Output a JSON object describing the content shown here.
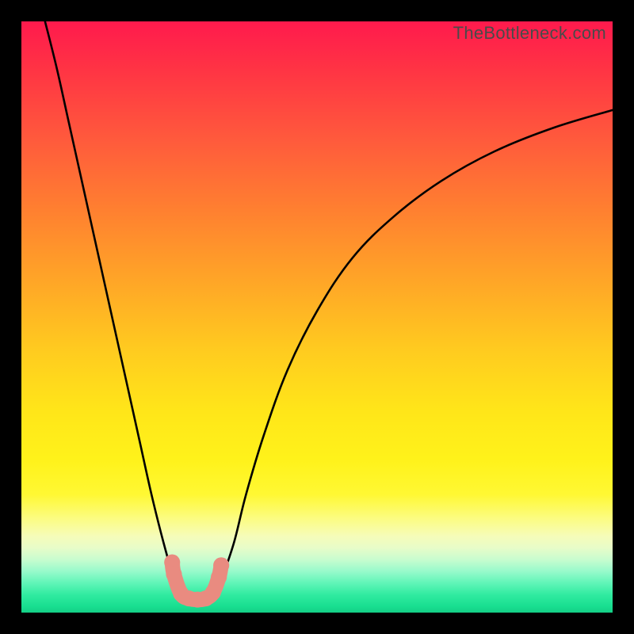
{
  "attribution": "TheBottleneck.com",
  "chart_data": {
    "type": "line",
    "title": "",
    "xlabel": "",
    "ylabel": "",
    "ylim": [
      0,
      100
    ],
    "xlim": [
      0,
      100
    ],
    "series": [
      {
        "name": "left-left-curve",
        "x": [
          4,
          6,
          8,
          10,
          12,
          14,
          16,
          18,
          20,
          22,
          24,
          26,
          27
        ],
        "y": [
          100,
          92,
          83,
          74,
          65,
          56,
          47,
          38,
          29,
          20,
          12,
          5,
          3
        ]
      },
      {
        "name": "left-right-curve",
        "x": [
          33,
          34,
          36,
          38,
          41,
          45,
          50,
          56,
          63,
          71,
          80,
          90,
          100
        ],
        "y": [
          3,
          6,
          12,
          20,
          30,
          41,
          51,
          60,
          67,
          73,
          78,
          82,
          85
        ]
      }
    ],
    "valley_markers": {
      "name": "valley-dots",
      "points": [
        {
          "x": 25.5,
          "y": 8.5
        },
        {
          "x": 25.8,
          "y": 6.5
        },
        {
          "x": 27.0,
          "y": 3.2
        },
        {
          "x": 28.3,
          "y": 2.4
        },
        {
          "x": 29.8,
          "y": 2.2
        },
        {
          "x": 31.2,
          "y": 2.4
        },
        {
          "x": 32.4,
          "y": 3.4
        },
        {
          "x": 33.4,
          "y": 6.0
        },
        {
          "x": 33.8,
          "y": 8.0
        }
      ],
      "color": "#e98b80",
      "radius_pct": 1.35
    },
    "background_gradient": {
      "stops": [
        {
          "pos": 0.0,
          "color": "#ff1a4d"
        },
        {
          "pos": 0.8,
          "color": "#fff833"
        },
        {
          "pos": 1.0,
          "color": "#14ce85"
        }
      ]
    }
  }
}
